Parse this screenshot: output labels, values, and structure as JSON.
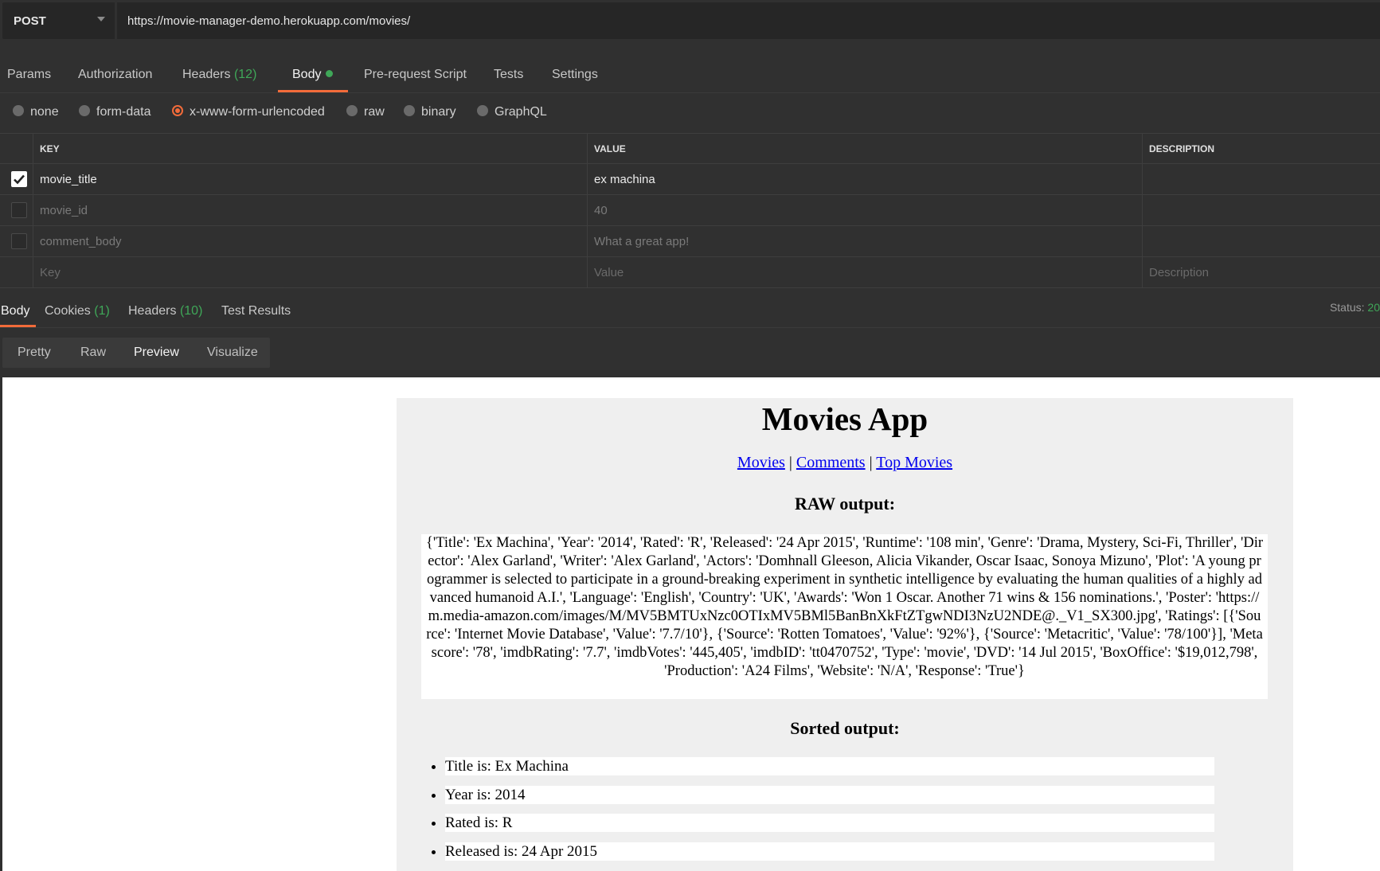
{
  "request": {
    "method": "POST",
    "url": "https://movie-manager-demo.herokuapp.com/movies/"
  },
  "request_tabs": [
    {
      "label": "Params",
      "count": ""
    },
    {
      "label": "Authorization",
      "count": ""
    },
    {
      "label": "Headers",
      "count": "(12)"
    },
    {
      "label": "Body",
      "count": ""
    },
    {
      "label": "Pre-request Script",
      "count": ""
    },
    {
      "label": "Tests",
      "count": ""
    },
    {
      "label": "Settings",
      "count": ""
    }
  ],
  "active_request_tab": "Body",
  "body_types": [
    "none",
    "form-data",
    "x-www-form-urlencoded",
    "raw",
    "binary",
    "GraphQL"
  ],
  "selected_body_type": "x-www-form-urlencoded",
  "kv_table": {
    "headers": [
      "KEY",
      "VALUE",
      "DESCRIPTION"
    ],
    "rows": [
      {
        "enabled": true,
        "key": "movie_title",
        "value": "ex machina",
        "description": ""
      },
      {
        "enabled": false,
        "key": "movie_id",
        "value": "40",
        "description": ""
      },
      {
        "enabled": false,
        "key": "comment_body",
        "value": "What a great app!",
        "description": ""
      }
    ],
    "placeholders": {
      "key": "Key",
      "value": "Value",
      "description": "Description"
    }
  },
  "response_tabs": [
    {
      "label": "Body",
      "count": ""
    },
    {
      "label": "Cookies",
      "count": "(1)"
    },
    {
      "label": "Headers",
      "count": "(10)"
    },
    {
      "label": "Test Results",
      "count": ""
    }
  ],
  "status": {
    "label": "Status:",
    "code": "20"
  },
  "view_modes": [
    "Pretty",
    "Raw",
    "Preview",
    "Visualize"
  ],
  "active_view": "Preview",
  "preview": {
    "title": "Movies App",
    "nav": [
      "Movies",
      "Comments",
      "Top Movies"
    ],
    "nav_sep": " | ",
    "raw_heading": "RAW output:",
    "raw_text": "{'Title': 'Ex Machina', 'Year': '2014', 'Rated': 'R', 'Released': '24 Apr 2015', 'Runtime': '108 min', 'Genre': 'Drama, Mystery, Sci-Fi, Thriller', 'Director': 'Alex Garland', 'Writer': 'Alex Garland', 'Actors': 'Domhnall Gleeson, Alicia Vikander, Oscar Isaac, Sonoya Mizuno', 'Plot': 'A young programmer is selected to participate in a ground-breaking experiment in synthetic intelligence by evaluating the human qualities of a highly advanced humanoid A.I.', 'Language': 'English', 'Country': 'UK', 'Awards': 'Won 1 Oscar. Another 71 wins & 156 nominations.', 'Poster': 'https://m.media-amazon.com/images/M/MV5BMTUxNzc0OTIxMV5BMl5BanBnXkFtZTgwNDI3NzU2NDE@._V1_SX300.jpg', 'Ratings': [{'Source': 'Internet Movie Database', 'Value': '7.7/10'}, {'Source': 'Rotten Tomatoes', 'Value': '92%'}, {'Source': 'Metacritic', 'Value': '78/100'}], 'Metascore': '78', 'imdbRating': '7.7', 'imdbVotes': '445,405', 'imdbID': 'tt0470752', 'Type': 'movie', 'DVD': '14 Jul 2015', 'BoxOffice': '$19,012,798', 'Production': 'A24 Films', 'Website': 'N/A', 'Response': 'True'}",
    "sorted_heading": "Sorted output:",
    "sorted_items": [
      "Title is: Ex Machina",
      "Year is: 2014",
      "Rated is: R",
      "Released is: 24 Apr 2015"
    ]
  },
  "colors": {
    "accent_orange": "#f26b3a",
    "count_green": "#3fa758",
    "background": "#303030",
    "link_blue": "#0000ee"
  },
  "icons": {
    "method_dropdown": "chevron-down-icon",
    "checked": "checkbox-checked-icon",
    "body_modified": "green-dot-indicator"
  }
}
